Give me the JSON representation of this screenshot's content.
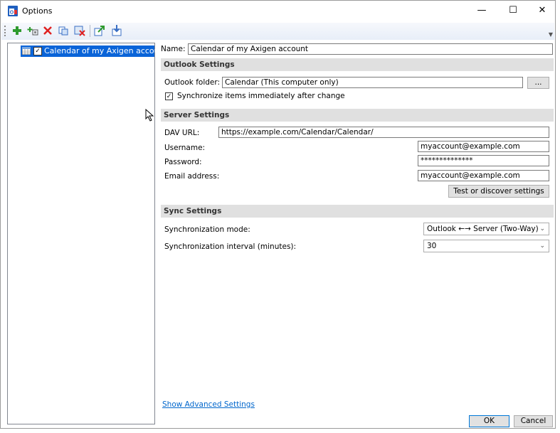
{
  "window": {
    "title": "Options"
  },
  "titlebar": {
    "minimize": "—",
    "maximize": "☐",
    "close": "✕"
  },
  "toolbar": {
    "icons": [
      "add-icon",
      "add-multiple-icon",
      "delete-icon",
      "copy-icon",
      "clear-cache-icon",
      "export-icon",
      "import-icon"
    ]
  },
  "tree": {
    "items": [
      {
        "label": "Calendar of my Axigen account",
        "checked": true
      }
    ]
  },
  "profile": {
    "name_label": "Name:",
    "name_value": "Calendar of my Axigen account"
  },
  "outlook": {
    "section_title": "Outlook Settings",
    "folder_label": "Outlook folder:",
    "folder_value": "Calendar (This computer only)",
    "browse_label": "...",
    "sync_immediately_label": "Synchronize items immediately after change",
    "sync_immediately_checked": true
  },
  "server": {
    "section_title": "Server Settings",
    "url_label": "DAV URL:",
    "url_value": "https://example.com/Calendar/Calendar/",
    "username_label": "Username:",
    "username_value": "myaccount@example.com",
    "password_label": "Password:",
    "password_value": "**************",
    "email_label": "Email address:",
    "email_value": "myaccount@example.com",
    "test_button": "Test or discover settings"
  },
  "sync": {
    "section_title": "Sync Settings",
    "mode_label": "Synchronization mode:",
    "mode_value": "Outlook ←→ Server (Two-Way)",
    "interval_label": "Synchronization interval (minutes):",
    "interval_value": "30"
  },
  "footer": {
    "advanced_link": "Show Advanced Settings",
    "ok": "OK",
    "cancel": "Cancel"
  }
}
